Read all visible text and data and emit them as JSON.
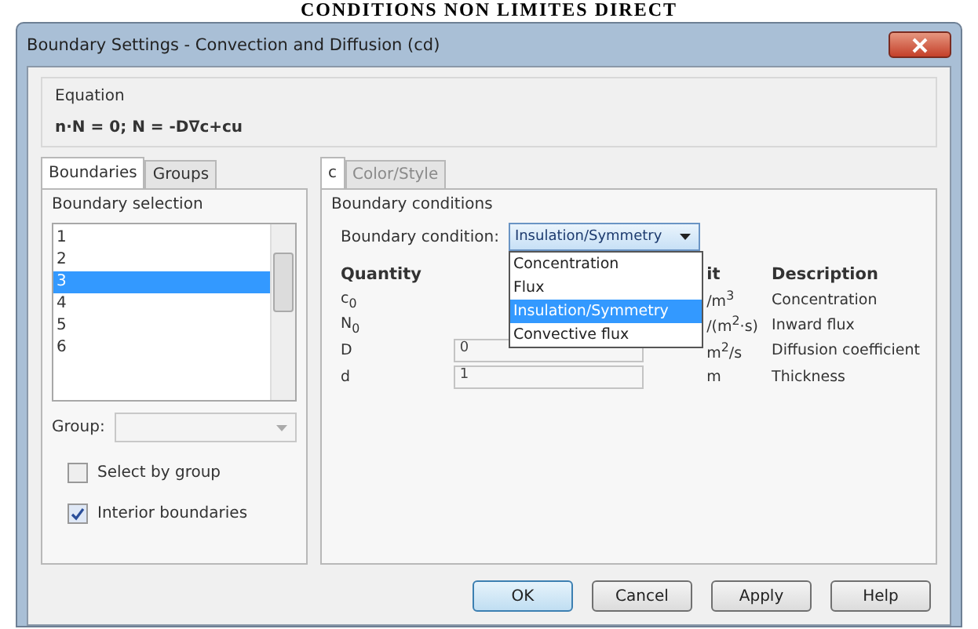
{
  "page_heading": "CONDITIONS NON LIMITES DIRECT",
  "window": {
    "title": "Boundary Settings - Convection and Diffusion (cd)"
  },
  "equation": {
    "label": "Equation",
    "text": "n·N = 0; N = -D∇c+cu"
  },
  "left_tabs": [
    {
      "label": "Boundaries",
      "selected": true
    },
    {
      "label": "Groups",
      "selected": false
    }
  ],
  "boundary_selection": {
    "label": "Boundary selection",
    "items": [
      {
        "label": "1",
        "selected": false
      },
      {
        "label": "2",
        "selected": false
      },
      {
        "label": "3",
        "selected": true
      },
      {
        "label": "4",
        "selected": false
      },
      {
        "label": "5",
        "selected": false
      },
      {
        "label": "6",
        "selected": false
      }
    ]
  },
  "group": {
    "label": "Group:"
  },
  "options": [
    {
      "label": "Select by group",
      "checked": false
    },
    {
      "label": "Interior boundaries",
      "checked": true
    }
  ],
  "right_tabs": [
    {
      "label": "c",
      "selected": true,
      "disabled": false
    },
    {
      "label": "Color/Style",
      "selected": false,
      "disabled": true
    }
  ],
  "boundary_conditions": {
    "label": "Boundary conditions",
    "field_label": "Boundary condition:",
    "value": "Insulation/Symmetry",
    "options": [
      {
        "label": "Concentration",
        "selected": false
      },
      {
        "label": "Flux",
        "selected": false
      },
      {
        "label": "Insulation/Symmetry",
        "selected": true
      },
      {
        "label": "Convective flux",
        "selected": false
      }
    ]
  },
  "table": {
    "columns": [
      "Quantity",
      "",
      "it",
      "Description"
    ],
    "rows": [
      {
        "quantity": "c$_{0}$",
        "value": "",
        "unit": "/m$^{3}$",
        "description": "Concentration"
      },
      {
        "quantity": "N$_{0}$",
        "value": "",
        "unit": "/(m$^{2}$·s)",
        "description": "Inward flux"
      },
      {
        "quantity": "D",
        "value": "0",
        "unit": "m$^{2}$/s",
        "description": "Diffusion coefficient"
      },
      {
        "quantity": "d",
        "value": "1",
        "unit": "m",
        "description": "Thickness"
      }
    ]
  },
  "buttons": [
    {
      "label": "OK",
      "default": true
    },
    {
      "label": "Cancel",
      "default": false
    },
    {
      "label": "Apply",
      "default": false
    },
    {
      "label": "Help",
      "default": false
    }
  ]
}
